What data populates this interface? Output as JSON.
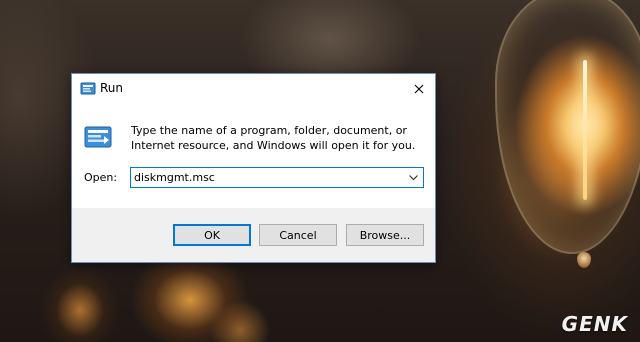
{
  "dialog": {
    "title": "Run",
    "message": "Type the name of a program, folder, document, or Internet resource, and Windows will open it for you.",
    "open_label": "Open:",
    "open_value": "diskmgmt.msc",
    "buttons": {
      "ok": "OK",
      "cancel": "Cancel",
      "browse": "Browse..."
    },
    "icons": {
      "title": "run-icon",
      "big": "run-icon",
      "close": "close-icon",
      "dropdown": "chevron-down-icon"
    },
    "accent_color": "#0078d7"
  },
  "watermark": {
    "text": "GENK"
  }
}
